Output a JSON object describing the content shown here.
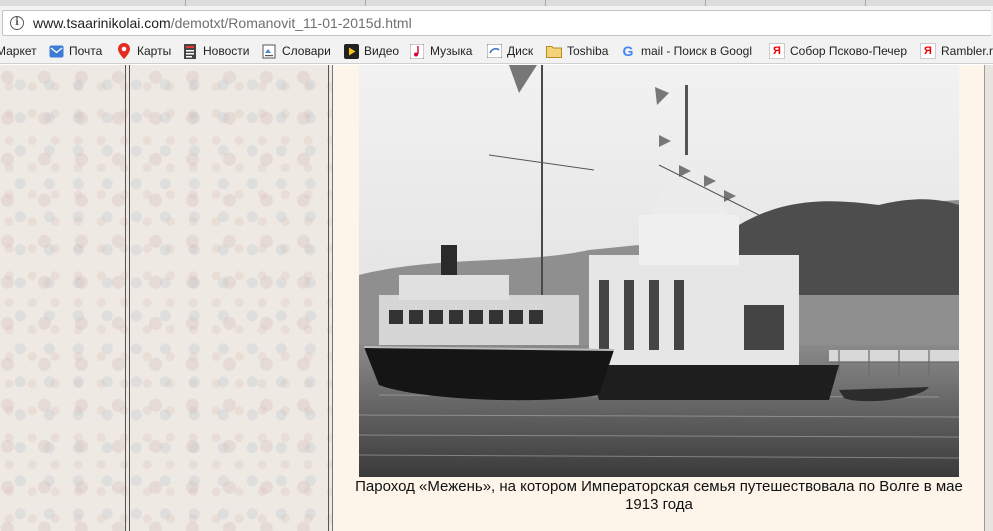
{
  "browser": {
    "url_host": "www.tsaarinikolai.com",
    "url_path": "/demotxt/Romanovit_11-01-2015d.html",
    "info_icon": "info-icon"
  },
  "bookmarks": [
    {
      "label": "Маркет",
      "icon": "none"
    },
    {
      "label": "Почта",
      "icon": "mail-icon"
    },
    {
      "label": "Карты",
      "icon": "map-pin-icon"
    },
    {
      "label": "Новости",
      "icon": "news-icon"
    },
    {
      "label": "Словари",
      "icon": "dictionary-icon"
    },
    {
      "label": "Видео",
      "icon": "video-icon"
    },
    {
      "label": "Музыка",
      "icon": "music-icon"
    },
    {
      "label": "Диск",
      "icon": "disk-icon"
    },
    {
      "label": "Toshiba",
      "icon": "folder-icon"
    },
    {
      "label": "mail - Поиск в Googl",
      "icon": "google-icon"
    },
    {
      "label": "Собор Псково-Печер",
      "icon": "yandex-icon"
    },
    {
      "label": "Rambler.r",
      "icon": "yandex-icon"
    }
  ],
  "content": {
    "caption": "Пароход «Межень», на котором Императорская семья путешествовала по Волге в мае 1913 года",
    "photo_icon": "steamship-photo"
  }
}
